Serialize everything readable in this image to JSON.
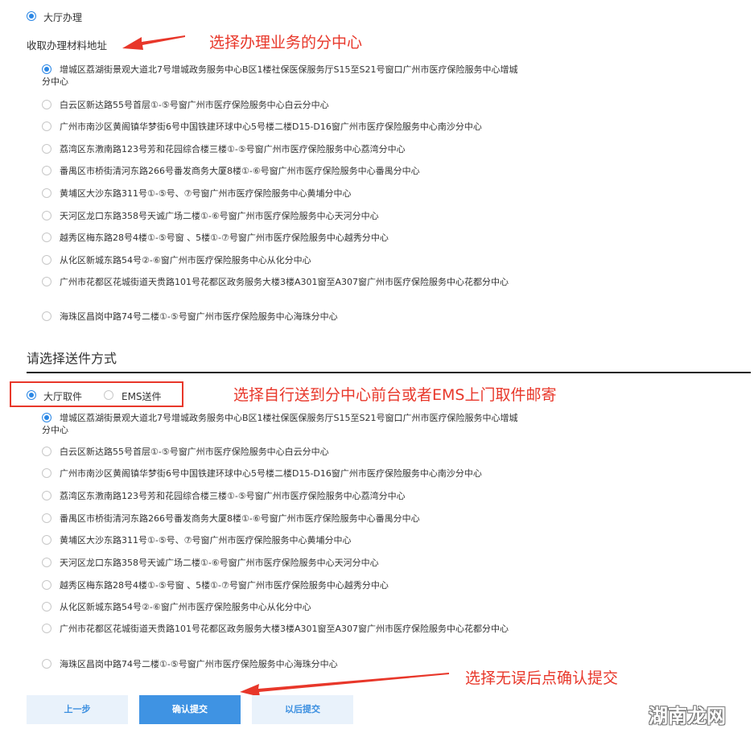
{
  "hall_option": {
    "label": "大厅办理",
    "selected": true
  },
  "address_section_label": "收取办理材料地址",
  "annotations": {
    "choose_center": "选择办理业务的分中心",
    "choose_delivery": "选择自行送到分中心前台或者EMS上门取件邮寄",
    "confirm_submit": "选择无误后点确认提交"
  },
  "addresses_1": [
    {
      "text": "增城区荔湖街景观大道北7号增城政务服务中心B区1楼社保医保服务厅S15至S21号窗口广州市医疗保险服务中心增城分中心",
      "selected": true
    },
    {
      "text": "白云区新达路55号首层①-⑤号窗广州市医疗保险服务中心白云分中心",
      "selected": false
    },
    {
      "text": "广州市南沙区黄阁镇华梦街6号中国铁建环球中心5号楼二楼D15-D16窗广州市医疗保险服务中心南沙分中心",
      "selected": false
    },
    {
      "text": "荔湾区东漖南路123号芳和花园综合楼三楼①-⑤号窗广州市医疗保险服务中心荔湾分中心",
      "selected": false
    },
    {
      "text": "番禺区市桥街清河东路266号番发商务大厦8楼①-⑥号窗广州市医疗保险服务中心番禺分中心",
      "selected": false
    },
    {
      "text": "黄埔区大沙东路311号①-⑤号、⑦号窗广州市医疗保险服务中心黄埔分中心",
      "selected": false
    },
    {
      "text": "天河区龙口东路358号天诚广场二楼①-⑥号窗广州市医疗保险服务中心天河分中心",
      "selected": false
    },
    {
      "text": "越秀区梅东路28号4楼①-⑤号窗 、5楼①-⑦号窗广州市医疗保险服务中心越秀分中心",
      "selected": false
    },
    {
      "text": "从化区新城东路54号②-⑥窗广州市医疗保险服务中心从化分中心",
      "selected": false
    },
    {
      "text": "广州市花都区花城街道天贵路101号花都区政务服务大楼3楼A301窗至A307窗广州市医疗保险服务中心花都分中心",
      "selected": false
    },
    {
      "text": "海珠区昌岗中路74号二楼①-⑤号窗广州市医疗保险服务中心海珠分中心",
      "selected": false
    }
  ],
  "delivery_section_title": "请选择送件方式",
  "delivery_methods": [
    {
      "label": "大厅取件",
      "selected": true
    },
    {
      "label": "EMS送件",
      "selected": false
    }
  ],
  "addresses_2": [
    {
      "text": "增城区荔湖街景观大道北7号增城政务服务中心B区1楼社保医保服务厅S15至S21号窗口广州市医疗保险服务中心增城分中心",
      "selected": true
    },
    {
      "text": "白云区新达路55号首层①-⑤号窗广州市医疗保险服务中心白云分中心",
      "selected": false
    },
    {
      "text": "广州市南沙区黄阁镇华梦街6号中国铁建环球中心5号楼二楼D15-D16窗广州市医疗保险服务中心南沙分中心",
      "selected": false
    },
    {
      "text": "荔湾区东漖南路123号芳和花园综合楼三楼①-⑤号窗广州市医疗保险服务中心荔湾分中心",
      "selected": false
    },
    {
      "text": "番禺区市桥街清河东路266号番发商务大厦8楼①-⑥号窗广州市医疗保险服务中心番禺分中心",
      "selected": false
    },
    {
      "text": "黄埔区大沙东路311号①-⑤号、⑦号窗广州市医疗保险服务中心黄埔分中心",
      "selected": false
    },
    {
      "text": "天河区龙口东路358号天诚广场二楼①-⑥号窗广州市医疗保险服务中心天河分中心",
      "selected": false
    },
    {
      "text": "越秀区梅东路28号4楼①-⑤号窗 、5楼①-⑦号窗广州市医疗保险服务中心越秀分中心",
      "selected": false
    },
    {
      "text": "从化区新城东路54号②-⑥窗广州市医疗保险服务中心从化分中心",
      "selected": false
    },
    {
      "text": "广州市花都区花城街道天贵路101号花都区政务服务大楼3楼A301窗至A307窗广州市医疗保险服务中心花都分中心",
      "selected": false
    },
    {
      "text": "海珠区昌岗中路74号二楼①-⑤号窗广州市医疗保险服务中心海珠分中心",
      "selected": false
    }
  ],
  "buttons": {
    "prev": "上一步",
    "confirm": "确认提交",
    "later": "以后提交"
  },
  "watermark": "湖南龙网",
  "colors": {
    "accent": "#2b87e5",
    "annotation": "#e8372a",
    "button_primary": "#3f93e3"
  }
}
